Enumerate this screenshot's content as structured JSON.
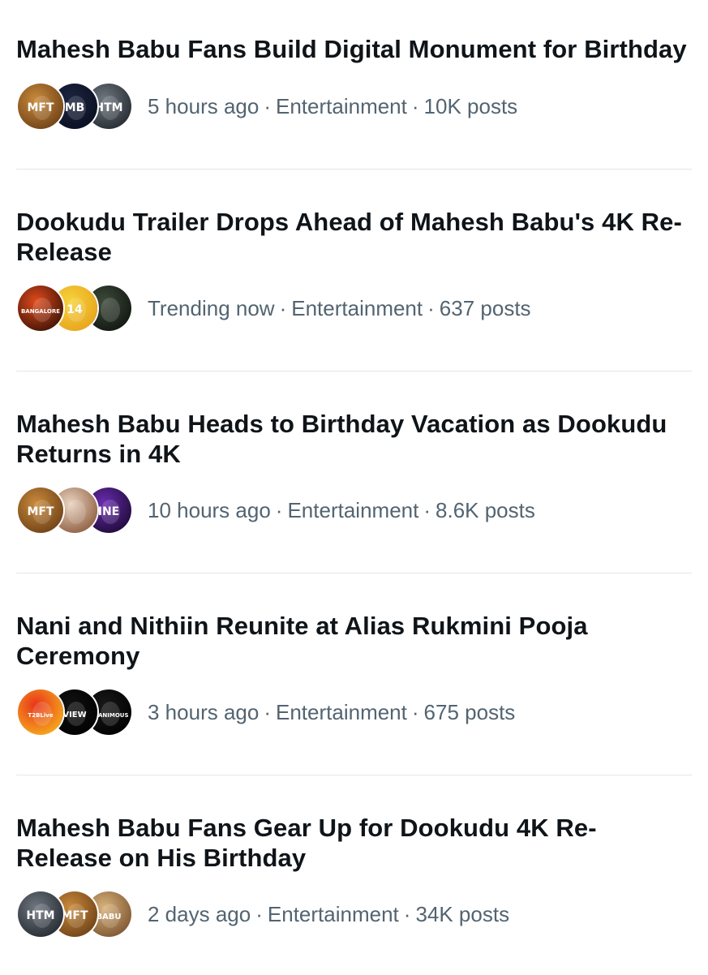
{
  "trends": [
    {
      "title": "Mahesh Babu Fans Build Digital Monument for Birthday",
      "time": "5 hours ago",
      "category": "Entertainment",
      "posts": "10K posts",
      "avatars": [
        {
          "label": "MFT",
          "colors": [
            "#c98a3b",
            "#6b3f16"
          ]
        },
        {
          "label": "MB",
          "colors": [
            "#1c2440",
            "#0a0f20"
          ]
        },
        {
          "label": "HTM",
          "colors": [
            "#6f7780",
            "#23282e"
          ]
        }
      ]
    },
    {
      "title": "Dookudu Trailer Drops Ahead of Mahesh Babu's 4K Re-Release",
      "time": "Trending now",
      "category": "Entertainment",
      "posts": "637 posts",
      "avatars": [
        {
          "label": "BANGALORE",
          "colors": [
            "#e04a1a",
            "#3a1206"
          ]
        },
        {
          "label": "14",
          "colors": [
            "#f5d23a",
            "#e8a21c"
          ]
        },
        {
          "label": "",
          "colors": [
            "#3d4a3a",
            "#101510"
          ]
        }
      ]
    },
    {
      "title": "Mahesh Babu Heads to Birthday Vacation as Dookudu Returns in 4K",
      "time": "10 hours ago",
      "category": "Entertainment",
      "posts": "8.6K posts",
      "avatars": [
        {
          "label": "MFT",
          "colors": [
            "#c98a3b",
            "#6b3f16"
          ]
        },
        {
          "label": "",
          "colors": [
            "#e9d3c0",
            "#8b5a3c"
          ]
        },
        {
          "label": "INE",
          "colors": [
            "#6b2bb0",
            "#1a0a33"
          ]
        }
      ]
    },
    {
      "title": "Nani and Nithiin Reunite at Alias Rukmini Pooja Ceremony",
      "time": "3 hours ago",
      "category": "Entertainment",
      "posts": "675 posts",
      "avatars": [
        {
          "label": "T2BLive",
          "colors": [
            "#e8331a",
            "#f6b21e"
          ]
        },
        {
          "label": "VIEW",
          "colors": [
            "#111111",
            "#000000"
          ]
        },
        {
          "label": "UNANIMOUS",
          "colors": [
            "#181818",
            "#000000"
          ]
        }
      ]
    },
    {
      "title": "Mahesh Babu Fans Gear Up for Dookudu 4K Re-Release on His Birthday",
      "time": "2 days ago",
      "category": "Entertainment",
      "posts": "34K posts",
      "avatars": [
        {
          "label": "HTM",
          "colors": [
            "#6f7780",
            "#23282e"
          ]
        },
        {
          "label": "MFT",
          "colors": [
            "#c98a3b",
            "#6b3f16"
          ]
        },
        {
          "label": "BABU",
          "colors": [
            "#d8b27a",
            "#7a5230"
          ]
        }
      ]
    }
  ]
}
